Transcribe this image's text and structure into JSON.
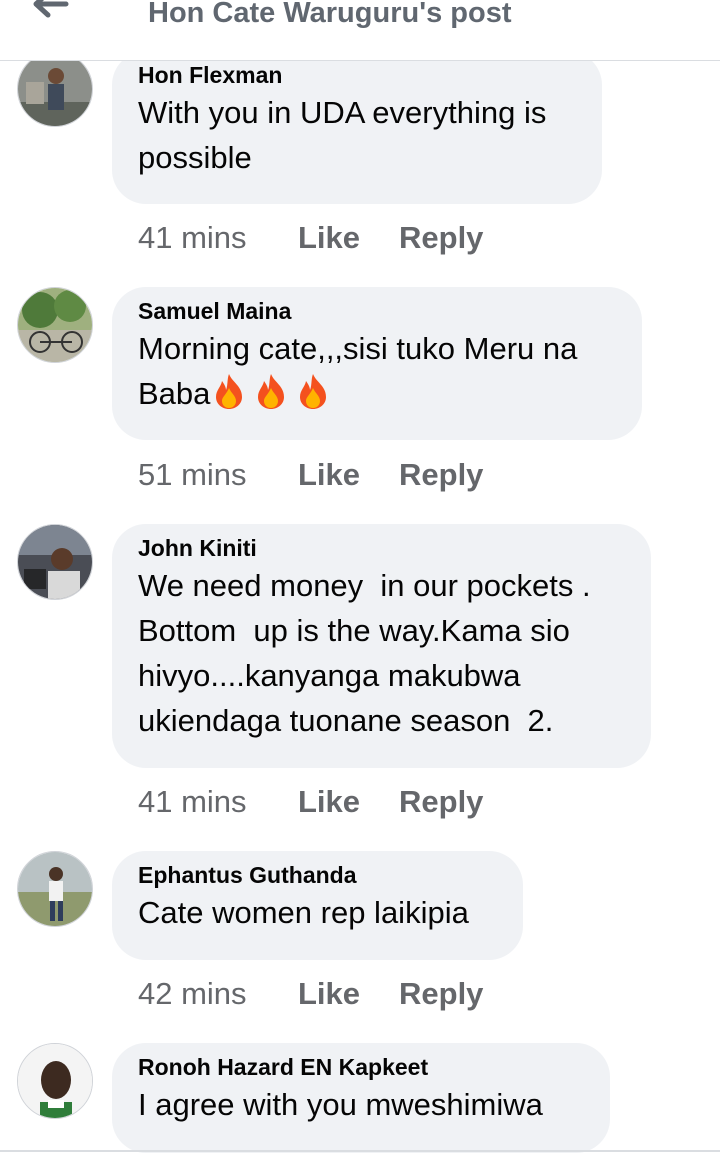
{
  "header": {
    "title": "Hon Cate Waruguru's post",
    "back_icon": "arrow-left-icon"
  },
  "colors": {
    "bubble": "#f0f2f5",
    "meta": "#65676b",
    "text": "#050505",
    "header_title": "#606770"
  },
  "comments": [
    {
      "author": "Hon Flexman",
      "text": "With you in UDA everything is\npossible",
      "time": "41 mins",
      "like": "Like",
      "reply": "Reply"
    },
    {
      "author": "Samuel Maina",
      "text": "Morning cate,,,sisi tuko Meru na\nBaba",
      "emoji": [
        "fire-emoji",
        "fire-emoji",
        "fire-emoji"
      ],
      "time": "51 mins",
      "like": "Like",
      "reply": "Reply"
    },
    {
      "author": "John Kiniti",
      "text": "We need money  in our pockets .\nBottom  up is the way.Kama sio\nhivyo....kanyanga makubwa\nukiendaga tuonane season  2.",
      "time": "41 mins",
      "like": "Like",
      "reply": "Reply"
    },
    {
      "author": "Ephantus Guthanda",
      "text": "Cate women rep laikipia",
      "time": "42 mins",
      "like": "Like",
      "reply": "Reply"
    },
    {
      "author": "Ronoh Hazard EN Kapkeet",
      "text": "I agree with you mweshimiwa"
    }
  ]
}
